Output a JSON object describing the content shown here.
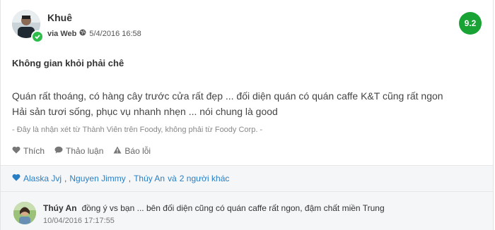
{
  "author": {
    "name": "Khuê",
    "via": "via Web",
    "date": "5/4/2016 16:58",
    "score": "9.2"
  },
  "review": {
    "title": "Không gian khỏi phải chê",
    "lines": [
      "Quán rất thoáng, có hàng cây trước cửa rất đẹp ... đối diện quán có quán caffe K&T cũng rất ngon",
      "Hải sản tươi sống, phục vụ nhanh nhẹn ... nói chung là good"
    ],
    "disclaimer": "- Đây là nhận xét từ Thành Viên trên Foody, không phải từ Foody Corp. -"
  },
  "actions": {
    "like": "Thích",
    "discuss": "Thảo luận",
    "report": "Báo lỗi"
  },
  "likes": {
    "names": [
      "Alaska Jvj",
      "Nguyen Jimmy",
      "Thúy An"
    ],
    "and_text": "và",
    "others": "2 người khác"
  },
  "comment": {
    "name": "Thúy An",
    "text": "đồng ý vs bạn ... bên đối diện cũng có quán caffe rất ngon, đậm chất miền Trung",
    "time": "10/04/2016 17:17:55"
  },
  "colors": {
    "score_bg": "#1aa335",
    "link": "#2a7fc3",
    "verified": "#2ebd4b"
  }
}
